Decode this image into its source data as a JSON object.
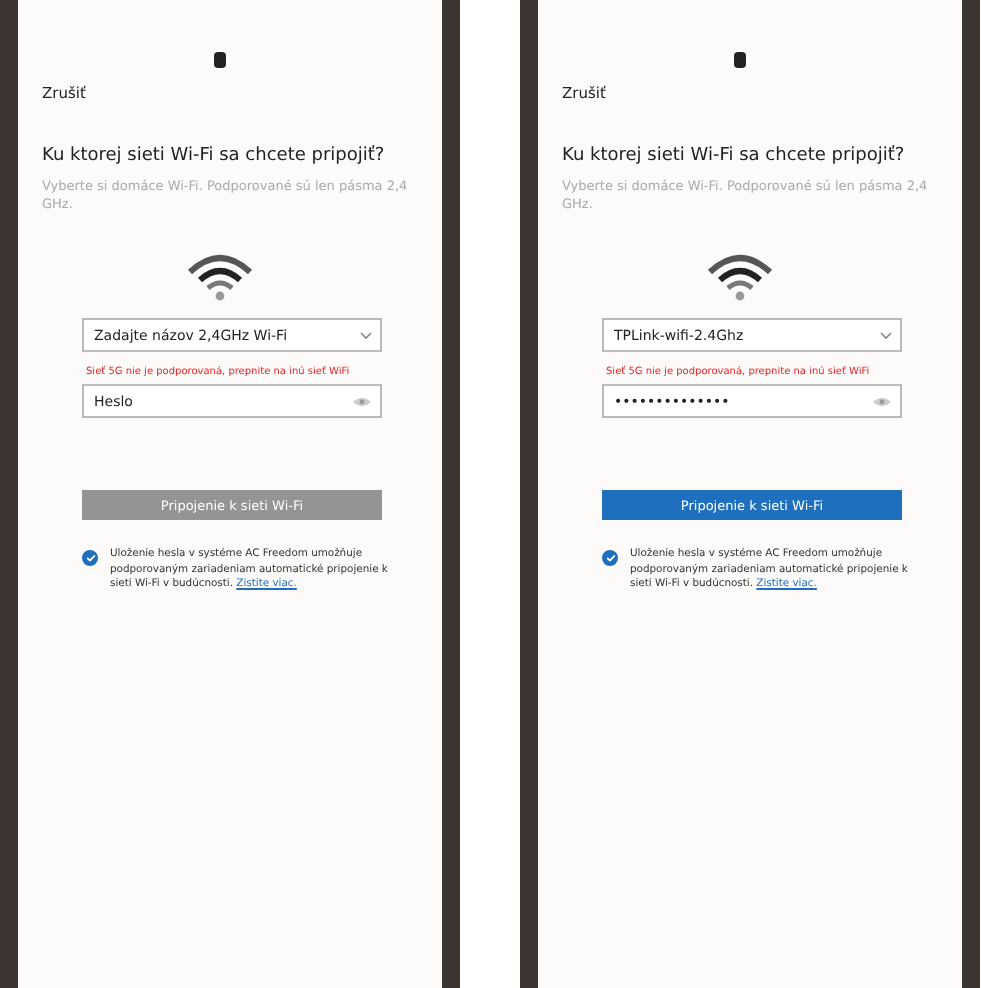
{
  "phones": [
    {
      "cancel": "Zrušiť",
      "title": "Ku ktorej sieti Wi-Fi sa chcete pripojiť?",
      "subtitle": "Vyberte si domáce Wi-Fi. Podporované sú len pásma 2,4 GHz.",
      "network_field": {
        "placeholder": "Zadajte názov 2,4GHz Wi-Fi"
      },
      "error": "Sieť 5G nie je podporovaná, prepnite na inú sieť WiFi",
      "password_field": {
        "placeholder": "Heslo"
      },
      "connect_button": {
        "label": "Pripojenie k sieti Wi-Fi",
        "disabled": true
      },
      "save_password": {
        "checked": true,
        "text": "Uloženie hesla v systéme AC Freedom umožňuje podporovaným zariadeniam automatické pripojenie k sieti Wi-Fi v budúcnosti.",
        "link": "Zistite viac."
      }
    },
    {
      "cancel": "Zrušiť",
      "title": "Ku ktorej sieti Wi-Fi sa chcete pripojiť?",
      "subtitle": "Vyberte si domáce Wi-Fi. Podporované sú len pásma 2,4 GHz.",
      "network_field": {
        "value": "TPLink-wifi-2.4Ghz"
      },
      "error": "Sieť 5G nie je podporovaná, prepnite na inú sieť WiFi",
      "password_field": {
        "value": "••••••••••••••"
      },
      "connect_button": {
        "label": "Pripojenie k sieti Wi-Fi",
        "disabled": false
      },
      "save_password": {
        "checked": true,
        "text": "Uloženie hesla v systéme AC Freedom umožňuje podporovaným zariadeniam automatické pripojenie k sieti Wi-Fi v budúcnosti.",
        "link": "Zistite viac."
      }
    }
  ]
}
